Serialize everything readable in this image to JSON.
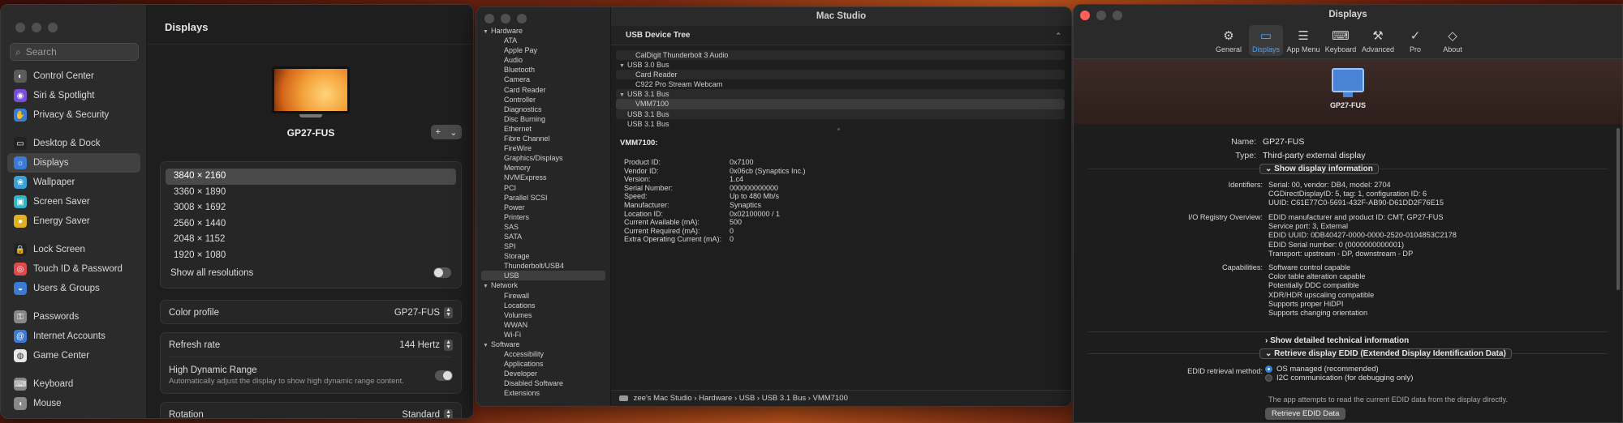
{
  "settings": {
    "search_placeholder": "Search",
    "sidebar": [
      {
        "label": "Control Center",
        "color": "#5b5b5b",
        "glyph": "◐"
      },
      {
        "label": "Siri & Spotlight",
        "color": "#7b4ddb",
        "glyph": "◉"
      },
      {
        "label": "Privacy & Security",
        "color": "#3a7bd5",
        "glyph": "✋"
      },
      {
        "label": "Desktop & Dock",
        "color": "#222222",
        "glyph": "▭"
      },
      {
        "label": "Displays",
        "color": "#3a7bd5",
        "glyph": "☼"
      },
      {
        "label": "Wallpaper",
        "color": "#3aa0d5",
        "glyph": "❀"
      },
      {
        "label": "Screen Saver",
        "color": "#33b3c9",
        "glyph": "▣"
      },
      {
        "label": "Energy Saver",
        "color": "#e0b020",
        "glyph": "●"
      },
      {
        "label": "Lock Screen",
        "color": "#222222",
        "glyph": "🔒"
      },
      {
        "label": "Touch ID & Password",
        "color": "#e14a4a",
        "glyph": "◎"
      },
      {
        "label": "Users & Groups",
        "color": "#3a7bd5",
        "glyph": "◒"
      },
      {
        "label": "Passwords",
        "color": "#888888",
        "glyph": "⚿"
      },
      {
        "label": "Internet Accounts",
        "color": "#3a7bd5",
        "glyph": "@"
      },
      {
        "label": "Game Center",
        "color": "#e8e8e8",
        "glyph": "◍"
      },
      {
        "label": "Keyboard",
        "color": "#888888",
        "glyph": "⌨"
      },
      {
        "label": "Mouse",
        "color": "#888888",
        "glyph": "◖"
      }
    ],
    "title": "Displays",
    "display_name": "GP27-FUS",
    "add_label": "+",
    "resolutions": [
      "3840 × 2160",
      "3360 × 1890",
      "3008 × 1692",
      "2560 × 1440",
      "2048 × 1152",
      "1920 × 1080"
    ],
    "show_all_label": "Show all resolutions",
    "color_profile_label": "Color profile",
    "color_profile_value": "GP27-FUS",
    "refresh_label": "Refresh rate",
    "refresh_value": "144 Hertz",
    "hdr_label": "High Dynamic Range",
    "hdr_sub": "Automatically adjust the display to show high dynamic range content.",
    "rotation_label": "Rotation",
    "rotation_value": "Standard"
  },
  "sysinfo": {
    "title": "Mac Studio",
    "tree": [
      {
        "label": "Hardware",
        "level": 0,
        "open": true
      },
      {
        "label": "ATA",
        "level": 1
      },
      {
        "label": "Apple Pay",
        "level": 1
      },
      {
        "label": "Audio",
        "level": 1
      },
      {
        "label": "Bluetooth",
        "level": 1
      },
      {
        "label": "Camera",
        "level": 1
      },
      {
        "label": "Card Reader",
        "level": 1
      },
      {
        "label": "Controller",
        "level": 1
      },
      {
        "label": "Diagnostics",
        "level": 1
      },
      {
        "label": "Disc Burning",
        "level": 1
      },
      {
        "label": "Ethernet",
        "level": 1
      },
      {
        "label": "Fibre Channel",
        "level": 1
      },
      {
        "label": "FireWire",
        "level": 1
      },
      {
        "label": "Graphics/Displays",
        "level": 1
      },
      {
        "label": "Memory",
        "level": 1
      },
      {
        "label": "NVMExpress",
        "level": 1
      },
      {
        "label": "PCI",
        "level": 1
      },
      {
        "label": "Parallel SCSI",
        "level": 1
      },
      {
        "label": "Power",
        "level": 1
      },
      {
        "label": "Printers",
        "level": 1
      },
      {
        "label": "SAS",
        "level": 1
      },
      {
        "label": "SATA",
        "level": 1
      },
      {
        "label": "SPI",
        "level": 1
      },
      {
        "label": "Storage",
        "level": 1
      },
      {
        "label": "Thunderbolt/USB4",
        "level": 1
      },
      {
        "label": "USB",
        "level": 1,
        "selected": true
      },
      {
        "label": "Network",
        "level": 0,
        "open": true
      },
      {
        "label": "Firewall",
        "level": 1
      },
      {
        "label": "Locations",
        "level": 1
      },
      {
        "label": "Volumes",
        "level": 1
      },
      {
        "label": "WWAN",
        "level": 1
      },
      {
        "label": "Wi-Fi",
        "level": 1
      },
      {
        "label": "Software",
        "level": 0,
        "open": true
      },
      {
        "label": "Accessibility",
        "level": 1
      },
      {
        "label": "Applications",
        "level": 1
      },
      {
        "label": "Developer",
        "level": 1
      },
      {
        "label": "Disabled Software",
        "level": 1
      },
      {
        "label": "Extensions",
        "level": 1
      }
    ],
    "usb_header": "USB Device Tree",
    "usb_tree": [
      {
        "label": "CalDigit Thunderbolt 3 Audio",
        "indent": 2,
        "alt": true
      },
      {
        "label": "USB 3.0 Bus",
        "indent": 0,
        "open": true
      },
      {
        "label": "Card Reader",
        "indent": 2,
        "alt": true
      },
      {
        "label": "C922 Pro Stream Webcam",
        "indent": 2
      },
      {
        "label": "USB 3.1 Bus",
        "indent": 0,
        "open": true,
        "alt": true
      },
      {
        "label": "VMM7100",
        "indent": 2,
        "selected": true
      },
      {
        "label": "USB 3.1 Bus",
        "indent": 1,
        "alt": true
      },
      {
        "label": "USB 3.1 Bus",
        "indent": 1
      }
    ],
    "detail_title": "VMM7100:",
    "details": [
      {
        "k": "Product ID:",
        "v": "0x7100"
      },
      {
        "k": "Vendor ID:",
        "v": "0x06cb  (Synaptics Inc.)"
      },
      {
        "k": "Version:",
        "v": "1.c4"
      },
      {
        "k": "Serial Number:",
        "v": "000000000000"
      },
      {
        "k": "Speed:",
        "v": "Up to 480 Mb/s"
      },
      {
        "k": "Manufacturer:",
        "v": "Synaptics"
      },
      {
        "k": "Location ID:",
        "v": "0x02100000 / 1"
      },
      {
        "k": "Current Available (mA):",
        "v": "500"
      },
      {
        "k": "Current Required (mA):",
        "v": "0"
      },
      {
        "k": "Extra Operating Current (mA):",
        "v": "0"
      }
    ],
    "path": "zee's Mac Studio › Hardware › USB › USB 3.1 Bus › VMM7100"
  },
  "srx": {
    "title": "Displays",
    "tabs": [
      {
        "label": "General",
        "glyph": "⚙"
      },
      {
        "label": "Displays",
        "glyph": "▭",
        "selected": true
      },
      {
        "label": "App Menu",
        "glyph": "☰"
      },
      {
        "label": "Keyboard",
        "glyph": "⌨"
      },
      {
        "label": "Advanced",
        "glyph": "⚒"
      },
      {
        "label": "Pro",
        "glyph": "✓"
      },
      {
        "label": "About",
        "glyph": "◇"
      }
    ],
    "monitor_name": "GP27-FUS",
    "name_label": "Name:",
    "name_value": "GP27-FUS",
    "type_label": "Type:",
    "type_value": "Third-party external display",
    "show_info": "Show display information",
    "identifiers_label": "Identifiers:",
    "identifiers": [
      "Serial: 00, vendor: DB4, model: 2704",
      "CGDirectDisplayID: 5, tag: 1, configuration ID: 6",
      "UUID: C61E77C0-5691-432F-AB90-D61DD2F76E15"
    ],
    "io_label": "I/O Registry Overview:",
    "io": [
      "EDID manufacturer and product ID: CMT, GP27-FUS",
      "Service port: 3, External",
      "EDID UUID: 0DB40427-0000-0000-2520-0104853C2178",
      "EDID Serial number: 0 (0000000000001)",
      "Transport: upstream - DP, downstream - DP"
    ],
    "cap_label": "Capabilities:",
    "caps": [
      "Software control capable",
      "Color table alteration capable",
      "Potentially DDC compatible",
      "XDR/HDR upscaling compatible",
      "Supports proper HiDPI",
      "Supports changing orientation"
    ],
    "show_tech": "Show detailed technical information",
    "retrieve_head": "Retrieve display EDID (Extended Display Identification Data)",
    "edid_method_label": "EDID retrieval method:",
    "edid_opt1": "OS managed (recommended)",
    "edid_opt2": "I2C communication (for debugging only)",
    "edid_note": "The app attempts to read the current EDID data from the display directly.",
    "retrieve_btn": "Retrieve EDID Data"
  }
}
